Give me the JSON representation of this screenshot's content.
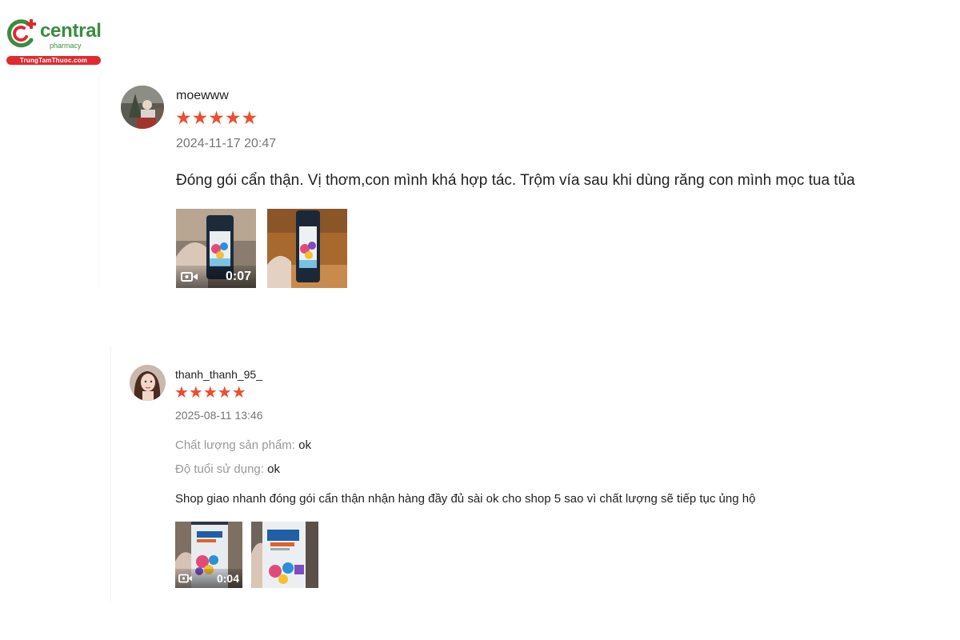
{
  "brand": {
    "name": "central",
    "sub": "pharmacy",
    "domain": "TrungTamThuoc.com",
    "colors": {
      "green": "#3a8d3f",
      "red": "#e02a2f"
    }
  },
  "reviews": [
    {
      "username": "moewww",
      "rating": 5,
      "stars": "★★★★★",
      "date": "2024-11-17 20:47",
      "comment": "Đóng gói cẩn thận. Vị thơm,con mình khá hợp tác. Trộm vía sau khi dùng răng con mình mọc tua tủa",
      "media": [
        {
          "kind": "video",
          "duration": "0:07",
          "icon": "video-camera-icon"
        },
        {
          "kind": "image"
        }
      ]
    },
    {
      "username": "thanh_thanh_95_",
      "rating": 5,
      "stars": "★★★★★",
      "date": "2025-08-11 13:46",
      "attributes": [
        {
          "label": "Chất lượng sản phẩm:",
          "value": "ok"
        },
        {
          "label": "Độ tuổi sử dụng:",
          "value": "ok"
        }
      ],
      "comment": "Shop giao nhanh đóng gói cẩn thận nhận hàng đầy đủ sài ok cho shop 5 sao vì chất lượng sẽ tiếp tục ủng hộ",
      "media": [
        {
          "kind": "video",
          "duration": "0:04",
          "icon": "video-camera-icon"
        },
        {
          "kind": "image"
        }
      ]
    }
  ],
  "accent": "#ee4d2d"
}
